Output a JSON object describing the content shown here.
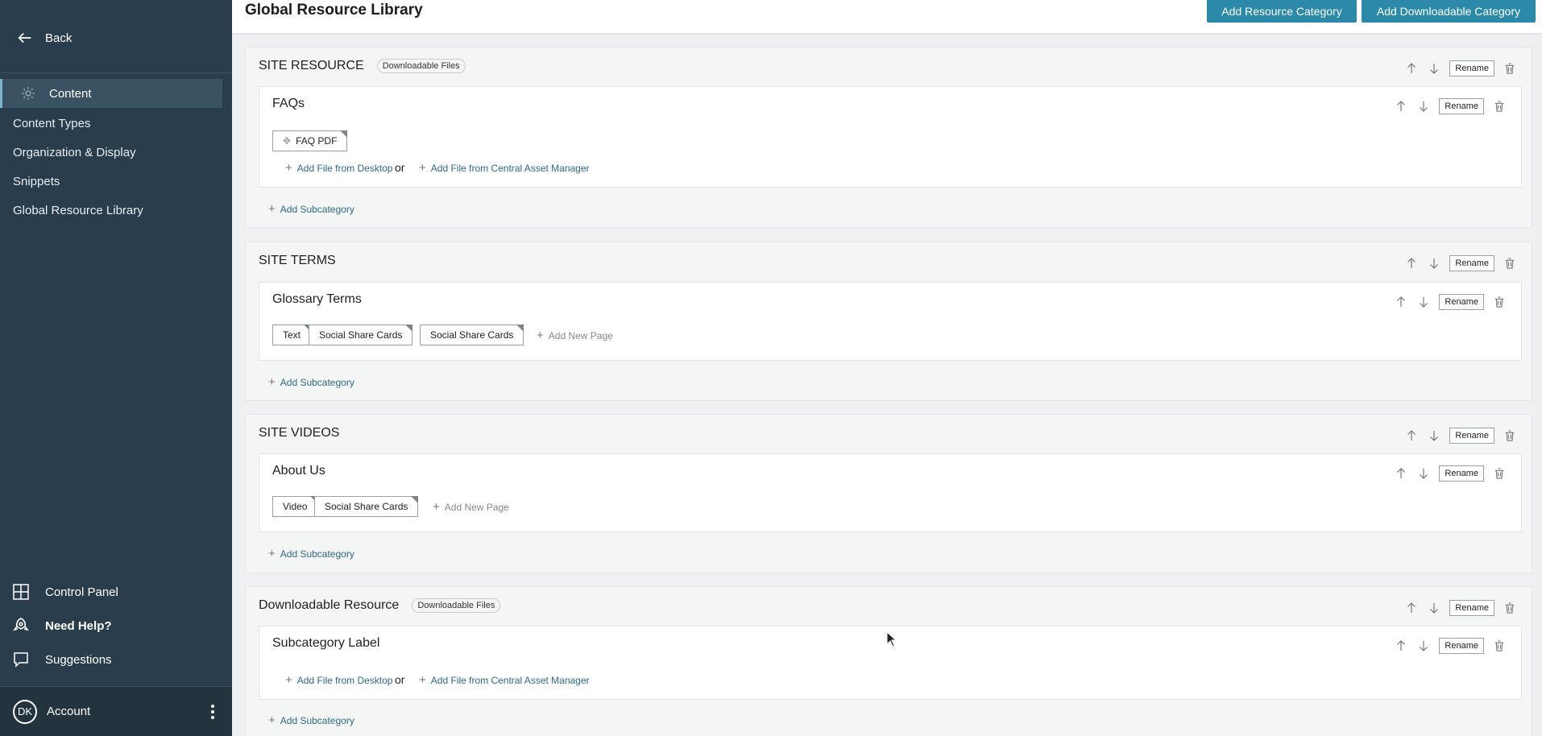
{
  "sidebar": {
    "back_label": "Back",
    "active_item": "Content",
    "items": [
      {
        "label": "Content Types"
      },
      {
        "label": "Organization & Display"
      },
      {
        "label": "Snippets"
      },
      {
        "label": "Global Resource Library"
      }
    ],
    "bottom": {
      "control_panel": "Control Panel",
      "need_help": "Need Help?",
      "suggestions": "Suggestions"
    },
    "account": {
      "initials": "DK",
      "label": "Account"
    }
  },
  "header": {
    "title": "Global Resource Library",
    "add_resource_category": "Add Resource Category",
    "add_downloadable_category": "Add Downloadable Category"
  },
  "common": {
    "rename": "Rename",
    "add_file_desktop": "Add File from Desktop",
    "or": "or",
    "add_file_cam": "Add File from Central Asset Manager",
    "add_subcategory": "Add Subcategory",
    "add_new_page": "Add New Page",
    "downloadable_files": "Downloadable Files"
  },
  "categories": [
    {
      "title": "SITE RESOURCE",
      "badge": "Downloadable Files",
      "subcategory": {
        "title": "FAQs",
        "chips": [
          "FAQ PDF"
        ]
      }
    },
    {
      "title": "SITE TERMS",
      "subcategory": {
        "title": "Glossary Terms",
        "chips": [
          "Text",
          "Social Share Cards",
          "Social Share Cards"
        ]
      }
    },
    {
      "title": "SITE VIDEOS",
      "subcategory": {
        "title": "About Us",
        "chips": [
          "Video",
          "Social Share Cards"
        ]
      }
    },
    {
      "title": "Downloadable Resource",
      "badge": "Downloadable Files",
      "subcategory": {
        "title": "Subcategory Label",
        "chips": []
      }
    }
  ],
  "colors": {
    "sidebar_bg": "#2a3d4c",
    "primary": "#2a8aa7",
    "link": "#2e6a80"
  }
}
